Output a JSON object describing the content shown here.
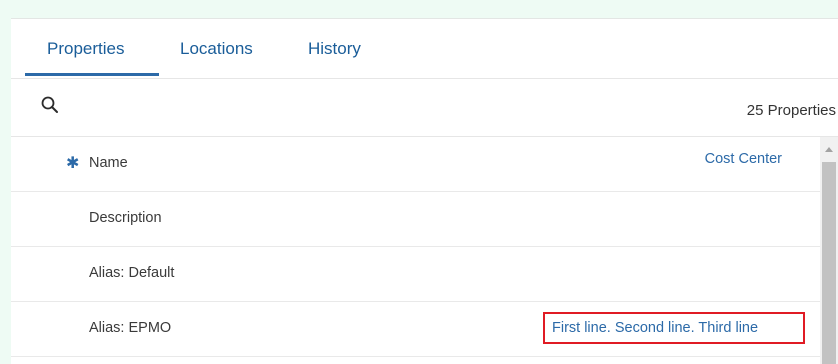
{
  "tabs": [
    {
      "label": "Properties",
      "active": true
    },
    {
      "label": "Locations",
      "active": false
    },
    {
      "label": "History",
      "active": false
    }
  ],
  "toolbar": {
    "search_icon": "search-icon",
    "count_label": "25 Properties"
  },
  "rows": [
    {
      "label": "Name",
      "required": true,
      "value": "Cost Center"
    },
    {
      "label": "Description",
      "value": ""
    },
    {
      "label": "Alias: Default",
      "value": ""
    },
    {
      "label": "Alias: EPMO",
      "value": "First line. Second line. Third line",
      "highlighted": true
    }
  ],
  "colors": {
    "accent": "#2c6aa8",
    "highlight_border": "#e01b24",
    "background": "#eefbf4"
  }
}
